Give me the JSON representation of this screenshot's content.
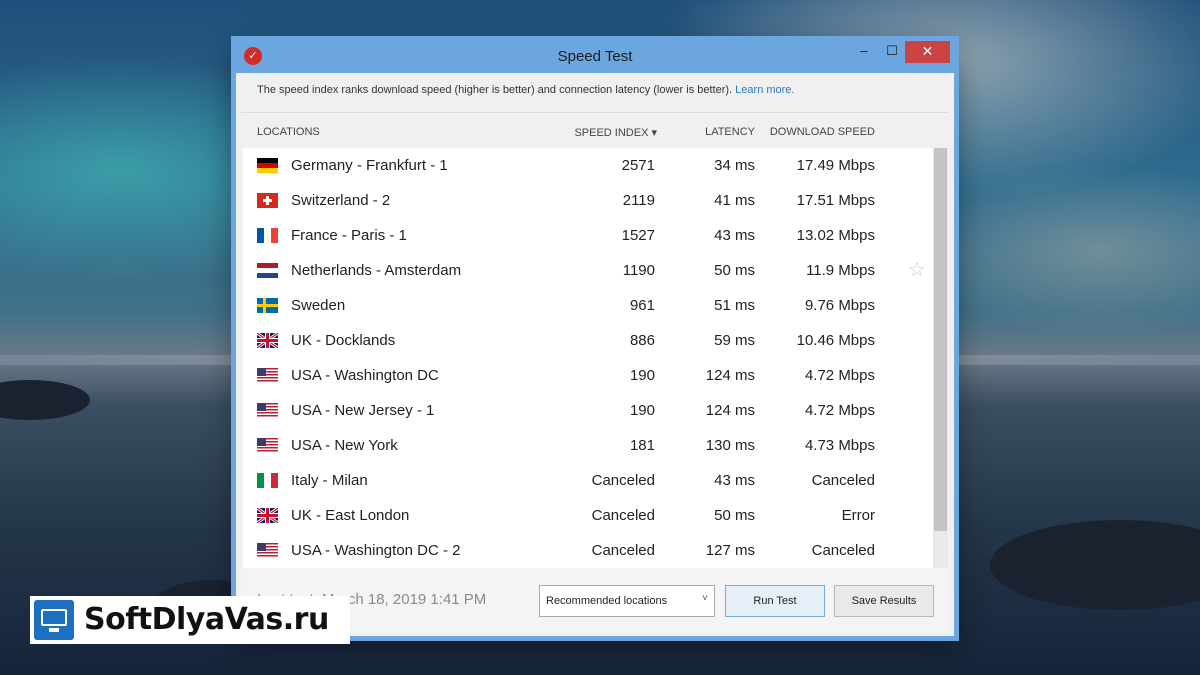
{
  "window": {
    "title": "Speed Test",
    "minimize": "–",
    "maximize": "☐",
    "close": "✕",
    "app_icon_glyph": "✓"
  },
  "info": {
    "text": "The speed index ranks download speed (higher is better) and connection latency (lower is better).",
    "link": "Learn more."
  },
  "columns": {
    "locations": "LOCATIONS",
    "speed_index": "SPEED INDEX ▾",
    "latency": "LATENCY",
    "download_speed": "DOWNLOAD SPEED"
  },
  "rows": [
    {
      "location": "Germany - Frankfurt - 1",
      "flag": "de",
      "speed_index": "2571",
      "latency": "34 ms",
      "download": "17.49 Mbps"
    },
    {
      "location": "Switzerland - 2",
      "flag": "ch",
      "speed_index": "2119",
      "latency": "41 ms",
      "download": "17.51 Mbps"
    },
    {
      "location": "France - Paris - 1",
      "flag": "fr",
      "speed_index": "1527",
      "latency": "43 ms",
      "download": "13.02 Mbps"
    },
    {
      "location": "Netherlands - Amsterdam",
      "flag": "nl",
      "speed_index": "1190",
      "latency": "50 ms",
      "download": "11.9 Mbps"
    },
    {
      "location": "Sweden",
      "flag": "se",
      "speed_index": "961",
      "latency": "51 ms",
      "download": "9.76 Mbps"
    },
    {
      "location": "UK - Docklands",
      "flag": "uk",
      "speed_index": "886",
      "latency": "59 ms",
      "download": "10.46 Mbps"
    },
    {
      "location": "USA - Washington DC",
      "flag": "us",
      "speed_index": "190",
      "latency": "124 ms",
      "download": "4.72 Mbps"
    },
    {
      "location": "USA - New Jersey - 1",
      "flag": "us",
      "speed_index": "190",
      "latency": "124 ms",
      "download": "4.72 Mbps"
    },
    {
      "location": "USA - New York",
      "flag": "us",
      "speed_index": "181",
      "latency": "130 ms",
      "download": "4.73 Mbps"
    },
    {
      "location": "Italy - Milan",
      "flag": "it",
      "speed_index": "Canceled",
      "latency": "43 ms",
      "download": "Canceled"
    },
    {
      "location": "UK - East London",
      "flag": "uk",
      "speed_index": "Canceled",
      "latency": "50 ms",
      "download": "Error"
    },
    {
      "location": "USA - Washington DC - 2",
      "flag": "us",
      "speed_index": "Canceled",
      "latency": "127 ms",
      "download": "Canceled"
    }
  ],
  "favorite_icon": "☆",
  "footer": {
    "last_test": "Last test: March 18, 2019 1:41 PM",
    "location_filter": "Recommended locations",
    "filter_arrow": "˅",
    "run_test": "Run Test",
    "save_results": "Save Results"
  },
  "watermark": {
    "text": "SoftDlyaVas.ru"
  },
  "colors": {
    "titlebar": "#6ca6e0",
    "close_button": "#c94442",
    "link": "#2a78c8"
  }
}
